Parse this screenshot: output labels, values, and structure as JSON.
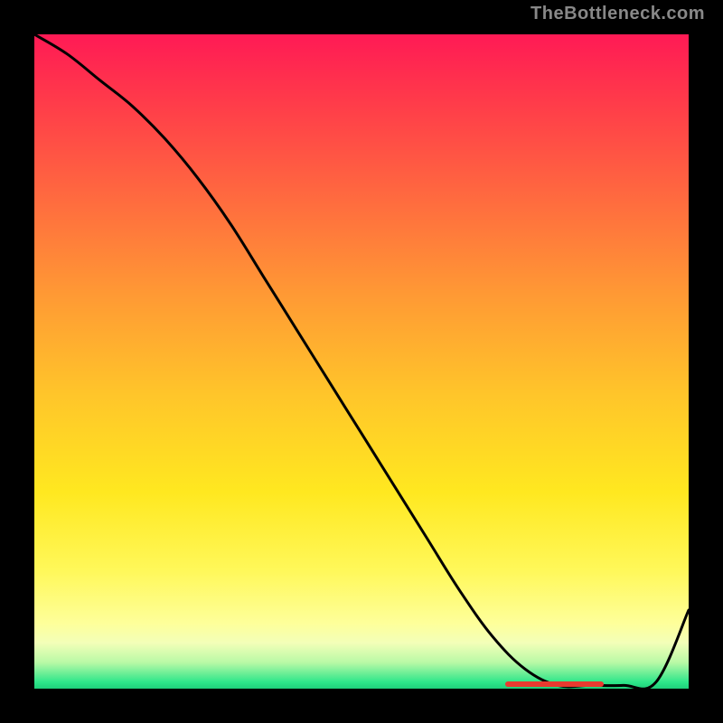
{
  "watermark": "TheBottleneck.com",
  "colors": {
    "page_bg": "#000000",
    "curve": "#000000",
    "bar": "#e83a2f"
  },
  "chart_data": {
    "type": "line",
    "title": "",
    "xlabel": "",
    "ylabel": "",
    "xlim": [
      0,
      100
    ],
    "ylim": [
      0,
      100
    ],
    "series": [
      {
        "name": "curve",
        "x": [
          0,
          5,
          10,
          15,
          20,
          25,
          30,
          35,
          40,
          45,
          50,
          55,
          60,
          65,
          70,
          75,
          80,
          85,
          90,
          95,
          100
        ],
        "y": [
          100,
          97,
          93,
          89,
          84,
          78,
          71,
          63,
          55,
          47,
          39,
          31,
          23,
          15,
          8,
          3,
          0.5,
          0.5,
          0.5,
          1,
          12
        ]
      }
    ],
    "highlight_bar": {
      "x_start": 72,
      "x_end": 87,
      "y": 0
    }
  }
}
